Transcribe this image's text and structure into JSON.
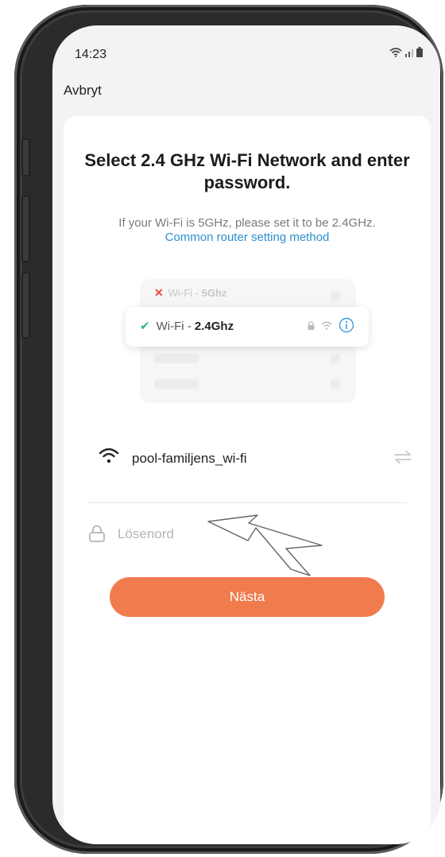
{
  "status_bar": {
    "time": "14:23"
  },
  "header": {
    "cancel_label": "Avbryt"
  },
  "card": {
    "title": "Select 2.4 GHz Wi-Fi Network and enter password.",
    "subtitle": "If your Wi-Fi is 5GHz, please set it to be 2.4GHz.",
    "link": "Common router setting method"
  },
  "illustration": {
    "bad_prefix": "Wi-Fi - ",
    "bad_band": "5Ghz",
    "good_prefix": "Wi-Fi - ",
    "good_band": "2.4Ghz"
  },
  "wifi": {
    "ssid": "pool-familjens_wi-fi"
  },
  "password": {
    "placeholder": "Lösenord",
    "value": ""
  },
  "next_button": {
    "label": "Nästa"
  },
  "colors": {
    "accent": "#f07b4d",
    "link": "#2c8fd0",
    "check": "#2cb67d",
    "cross": "#e9473f"
  }
}
